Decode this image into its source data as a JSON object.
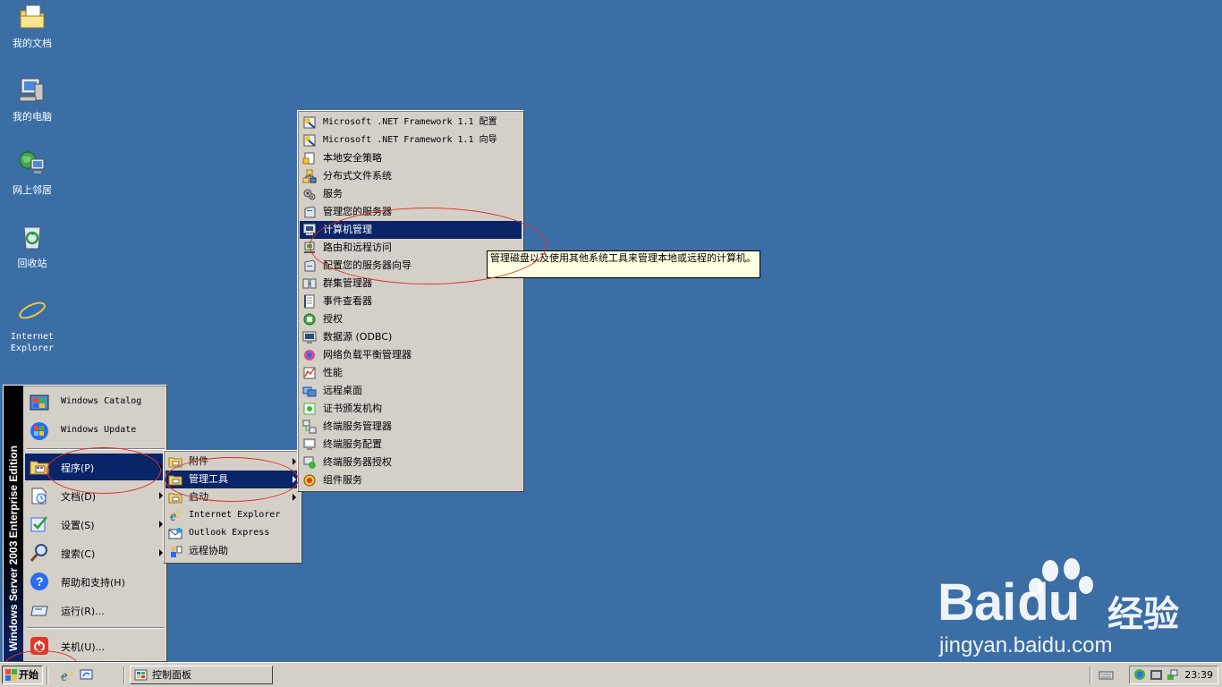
{
  "desktop": {
    "icons": [
      {
        "label": "我的文档",
        "icon": "my-documents-icon"
      },
      {
        "label": "我的电脑",
        "icon": "my-computer-icon"
      },
      {
        "label": "网上邻居",
        "icon": "network-places-icon"
      },
      {
        "label": "回收站",
        "icon": "recycle-bin-icon"
      },
      {
        "label": "Internet Explorer",
        "icon": "internet-explorer-icon"
      }
    ],
    "background": "#3a6ea5"
  },
  "start_menu": {
    "banner": "Windows Server 2003 Enterprise Edition",
    "items": [
      {
        "label": "Windows Catalog",
        "icon": "windows-catalog-icon"
      },
      {
        "label": "Windows Update",
        "icon": "windows-update-icon"
      },
      {
        "label": "程序(P)",
        "icon": "programs-folder-icon"
      },
      {
        "label": "文档(D)",
        "icon": "documents-icon"
      },
      {
        "label": "设置(S)",
        "icon": "settings-icon"
      },
      {
        "label": "搜索(C)",
        "icon": "search-icon"
      },
      {
        "label": "帮助和支持(H)",
        "icon": "help-icon"
      },
      {
        "label": "运行(R)...",
        "icon": "run-icon"
      },
      {
        "label": "关机(U)...",
        "icon": "shutdown-icon"
      }
    ]
  },
  "programs_menu": {
    "items": [
      {
        "label": "附件",
        "icon": "program-group-icon"
      },
      {
        "label": "管理工具",
        "icon": "program-group-icon"
      },
      {
        "label": "启动",
        "icon": "program-group-icon"
      },
      {
        "label": "Internet Explorer",
        "icon": "internet-explorer-icon"
      },
      {
        "label": "Outlook Express",
        "icon": "outlook-express-icon"
      },
      {
        "label": "远程协助",
        "icon": "remote-assistance-icon"
      }
    ]
  },
  "admin_tools_menu": {
    "items": [
      {
        "label": "Microsoft .NET Framework 1.1 配置",
        "icon": "dotnet-config-icon"
      },
      {
        "label": "Microsoft .NET Framework 1.1 向导",
        "icon": "dotnet-wizard-icon"
      },
      {
        "label": "本地安全策略",
        "icon": "security-policy-icon"
      },
      {
        "label": "分布式文件系统",
        "icon": "dfs-icon"
      },
      {
        "label": "服务",
        "icon": "services-icon"
      },
      {
        "label": "管理您的服务器",
        "icon": "manage-server-icon"
      },
      {
        "label": "计算机管理",
        "icon": "computer-management-icon"
      },
      {
        "label": "路由和远程访问",
        "icon": "routing-icon"
      },
      {
        "label": "配置您的服务器向导",
        "icon": "configure-server-icon"
      },
      {
        "label": "群集管理器",
        "icon": "cluster-icon"
      },
      {
        "label": "事件查看器",
        "icon": "event-viewer-icon"
      },
      {
        "label": "授权",
        "icon": "licensing-icon"
      },
      {
        "label": "数据源 (ODBC)",
        "icon": "odbc-icon"
      },
      {
        "label": "网络负载平衡管理器",
        "icon": "nlb-icon"
      },
      {
        "label": "性能",
        "icon": "performance-icon"
      },
      {
        "label": "远程桌面",
        "icon": "remote-desktop-icon"
      },
      {
        "label": "证书颁发机构",
        "icon": "certificate-icon"
      },
      {
        "label": "终端服务管理器",
        "icon": "terminal-manager-icon"
      },
      {
        "label": "终端服务配置",
        "icon": "terminal-config-icon"
      },
      {
        "label": "终端服务器授权",
        "icon": "terminal-license-icon"
      },
      {
        "label": "组件服务",
        "icon": "component-services-icon"
      }
    ]
  },
  "tooltip": {
    "text": "管理磁盘以及使用其他系统工具来管理本地或远程的计算机。"
  },
  "taskbar": {
    "start_label": "开始",
    "task_label": "控制面板",
    "clock": "23:39"
  },
  "watermark": {
    "brand": "Bai",
    "brand_tail": "du",
    "cn": "经验",
    "url": "jingyan.baidu.com"
  },
  "colors": {
    "selection": "#0a246a",
    "menu_face": "#d4d0c8",
    "tooltip_bg": "#ffffe1",
    "annotation_red": "#e0302a"
  }
}
